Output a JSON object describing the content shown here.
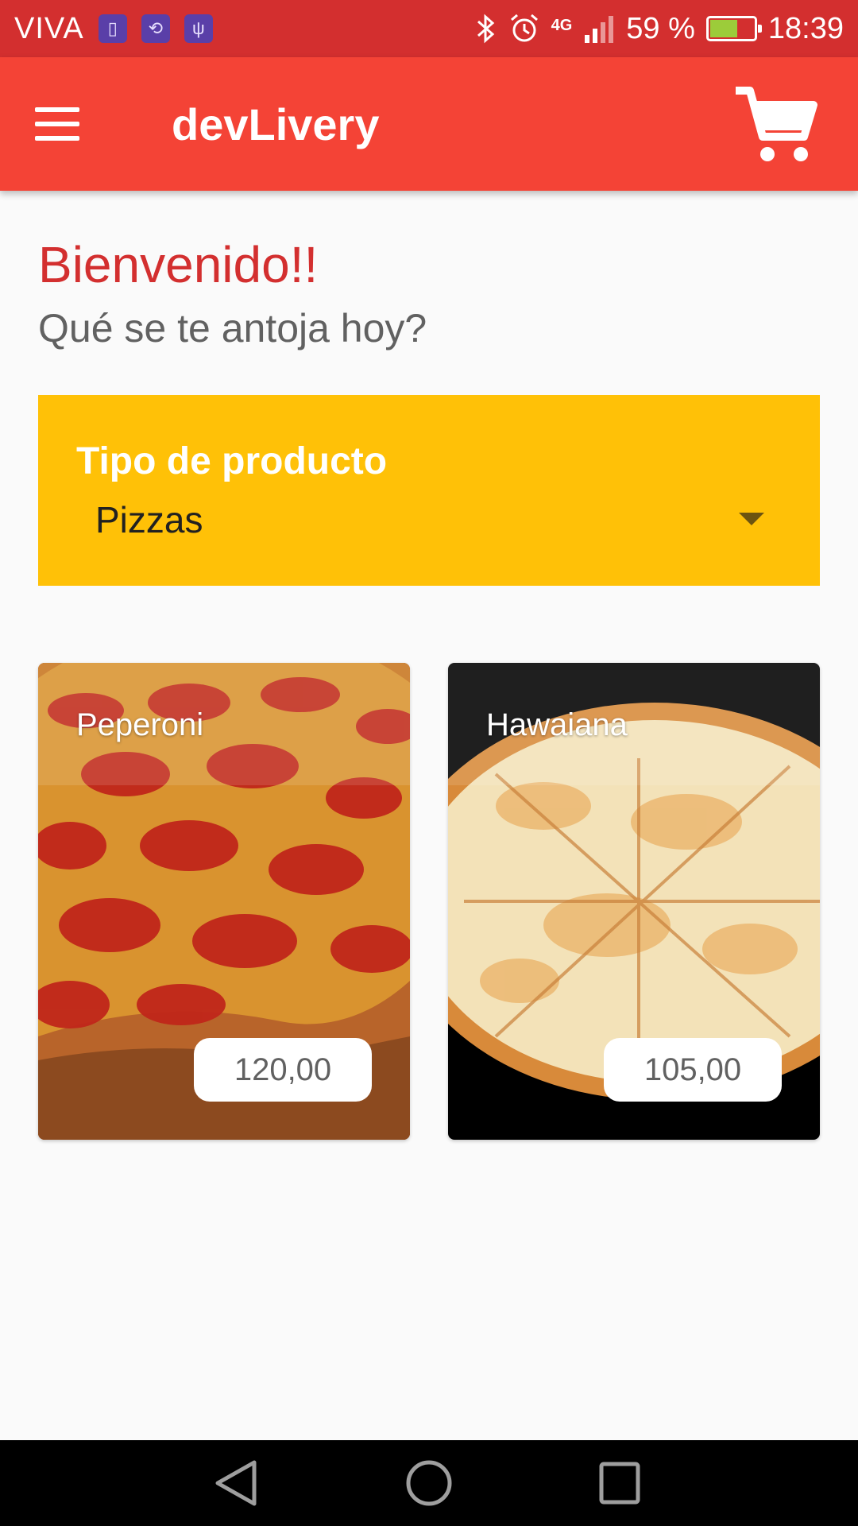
{
  "status_bar": {
    "carrier": "VIVA",
    "network": "4G",
    "battery_text": "59 %",
    "battery_level": 0.59,
    "time": "18:39"
  },
  "app_bar": {
    "title": "devLivery",
    "menu_icon": "hamburger-menu-icon",
    "cart_icon": "shopping-cart-icon"
  },
  "greeting": {
    "title": "Bienvenido!!",
    "subtitle": "Qué se te antoja hoy?"
  },
  "filter": {
    "label": "Tipo de producto",
    "selected": "Pizzas"
  },
  "products": [
    {
      "name": "Peperoni",
      "price": "120,00"
    },
    {
      "name": "Hawaiana",
      "price": "105,00"
    }
  ],
  "colors": {
    "status_bar": "#d32f2f",
    "app_bar": "#f44336",
    "accent_title": "#d32f2f",
    "filter_background": "#ffc107"
  }
}
